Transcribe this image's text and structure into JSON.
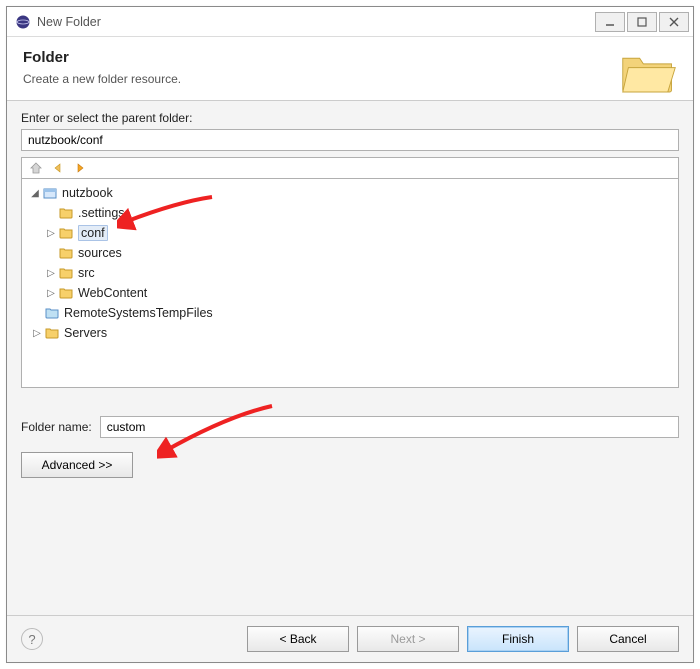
{
  "window": {
    "title": "New Folder"
  },
  "header": {
    "title": "Folder",
    "subtitle": "Create a new folder resource."
  },
  "body": {
    "parent_label": "Enter or select the parent folder:",
    "parent_value": "nutzbook/conf",
    "tree": {
      "root": "nutzbook",
      "items": [
        ".settings",
        "conf",
        "sources",
        "src",
        "WebContent"
      ],
      "siblings": [
        "RemoteSystemsTempFiles",
        "Servers"
      ]
    },
    "folder_name_label": "Folder name:",
    "folder_name_value": "custom",
    "advanced_label": "Advanced >>"
  },
  "footer": {
    "back": "< Back",
    "next": "Next >",
    "finish": "Finish",
    "cancel": "Cancel"
  }
}
